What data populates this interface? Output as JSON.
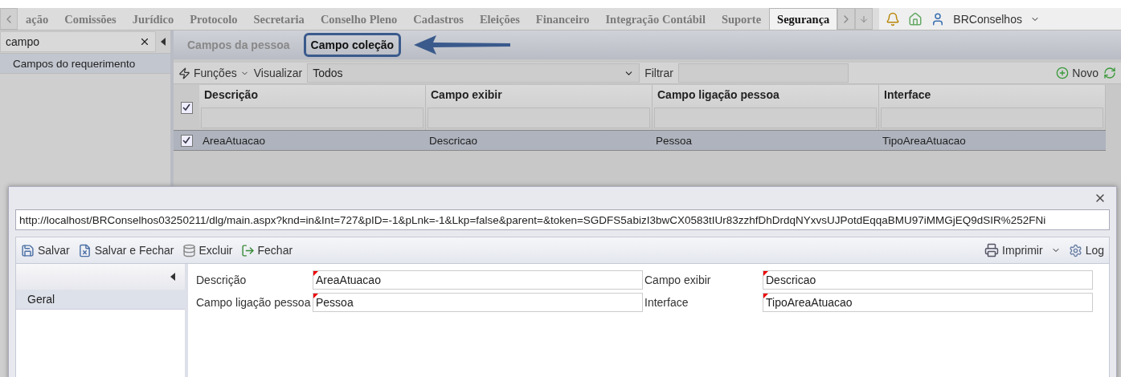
{
  "nav": {
    "tabs": [
      {
        "label": "ação",
        "selected": false
      },
      {
        "label": "Comissões",
        "selected": false
      },
      {
        "label": "Jurídico",
        "selected": false
      },
      {
        "label": "Protocolo",
        "selected": false
      },
      {
        "label": "Secretaria",
        "selected": false
      },
      {
        "label": "Conselho Pleno",
        "selected": false
      },
      {
        "label": "Cadastros",
        "selected": false
      },
      {
        "label": "Eleições",
        "selected": false
      },
      {
        "label": "Financeiro",
        "selected": false
      },
      {
        "label": "Integração Contábil",
        "selected": false
      },
      {
        "label": "Suporte",
        "selected": false
      },
      {
        "label": "Segurança",
        "selected": true
      }
    ],
    "user": "BRConselhos"
  },
  "sidebar": {
    "search": {
      "value": "campo"
    },
    "items": [
      {
        "label": "Campos do requerimento",
        "selected": true
      }
    ]
  },
  "subtabs": [
    {
      "label": "Campos da pessoa",
      "selected": false,
      "highlighted": false
    },
    {
      "label": "Campo coleção",
      "selected": true,
      "highlighted": true
    }
  ],
  "toolbar": {
    "functions": "Funções",
    "view_label": "Visualizar",
    "view_value": "Todos",
    "filter_label": "Filtrar",
    "new": "Novo"
  },
  "table": {
    "header_checked": true,
    "columns": [
      "Descrição",
      "Campo exibir",
      "Campo ligação pessoa",
      "Interface"
    ],
    "rows": [
      {
        "checked": true,
        "selected": true,
        "cells": [
          "AreaAtuacao",
          "Descricao",
          "Pessoa",
          "TipoAreaAtuacao"
        ]
      }
    ]
  },
  "dialog": {
    "url": "http://localhost/BRConselhos03250211/dlg/main.aspx?knd=in&Int=727&pID=-1&pLnk=-1&Lkp=false&parent=&token=SGDFS5abizI3bwCX0583tIUr83zzhfDhDrdqNYxvsUJPotdEqqaBMU97iMMGjEQ9dSIR%252FNi",
    "actions": [
      {
        "label": "Salvar",
        "kind": "save"
      },
      {
        "label": "Salvar e Fechar",
        "kind": "save-close"
      },
      {
        "label": "Excluir",
        "kind": "delete"
      },
      {
        "label": "Fechar",
        "kind": "close"
      }
    ],
    "print": "Imprimir",
    "log": "Log",
    "side_items": [
      {
        "label": "Geral",
        "selected": true
      }
    ],
    "fields": [
      {
        "label": "Descrição",
        "value": "AreaAtuacao",
        "required": true
      },
      {
        "label": "Campo exibir",
        "value": "Descricao",
        "required": true
      },
      {
        "label": "Campo ligação pessoa",
        "value": "Pessoa",
        "required": true
      },
      {
        "label": "Interface",
        "value": "TipoAreaAtuacao",
        "required": true
      }
    ]
  }
}
